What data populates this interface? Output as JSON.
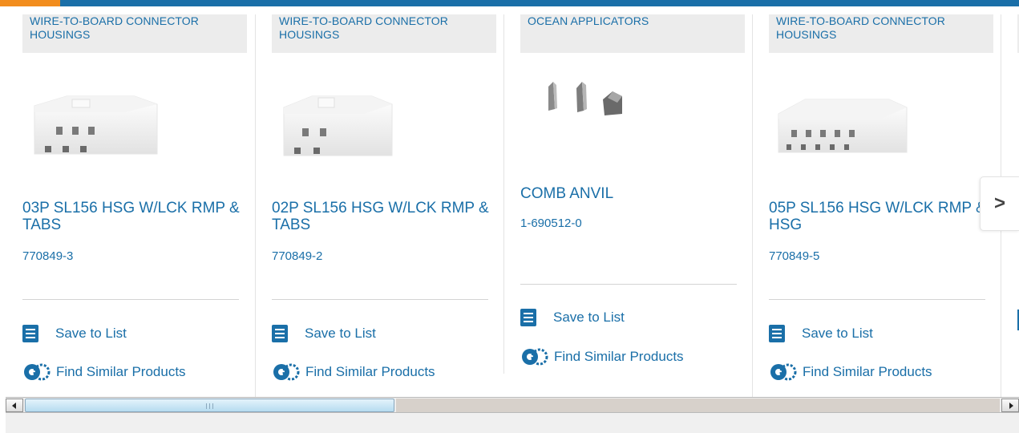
{
  "colors": {
    "brand_blue": "#1a6fa8",
    "accent_orange": "#f28d1d",
    "category_bg": "#ececec"
  },
  "carousel": {
    "next_icon": "chevron-right-icon",
    "next_label": ">",
    "cards": [
      {
        "category": "WIRE-TO-BOARD CONNECTOR HOUSINGS",
        "title": "03P SL156 HSG W/LCK RMP & TABS",
        "part_number": "770849-3",
        "save_label": "Save to List",
        "similar_label": "Find Similar Products",
        "image": "3-position connector housing"
      },
      {
        "category": "WIRE-TO-BOARD CONNECTOR HOUSINGS",
        "title": "02P SL156 HSG W/LCK RMP & TABS",
        "part_number": "770849-2",
        "save_label": "Save to List",
        "similar_label": "Find Similar Products",
        "image": "2-position connector housing"
      },
      {
        "category": "OCEAN APPLICATORS",
        "title": "COMB ANVIL",
        "part_number": "1-690512-0",
        "save_label": "Save to List",
        "similar_label": "Find Similar Products",
        "image": "applicator anvil parts"
      },
      {
        "category": "WIRE-TO-BOARD CONNECTOR HOUSINGS",
        "title": "05P SL156 HSG W/LCK RMP & HSG",
        "part_number": "770849-5",
        "save_label": "Save to List",
        "similar_label": "Find Similar Products",
        "image": "5-position connector housing"
      }
    ]
  }
}
